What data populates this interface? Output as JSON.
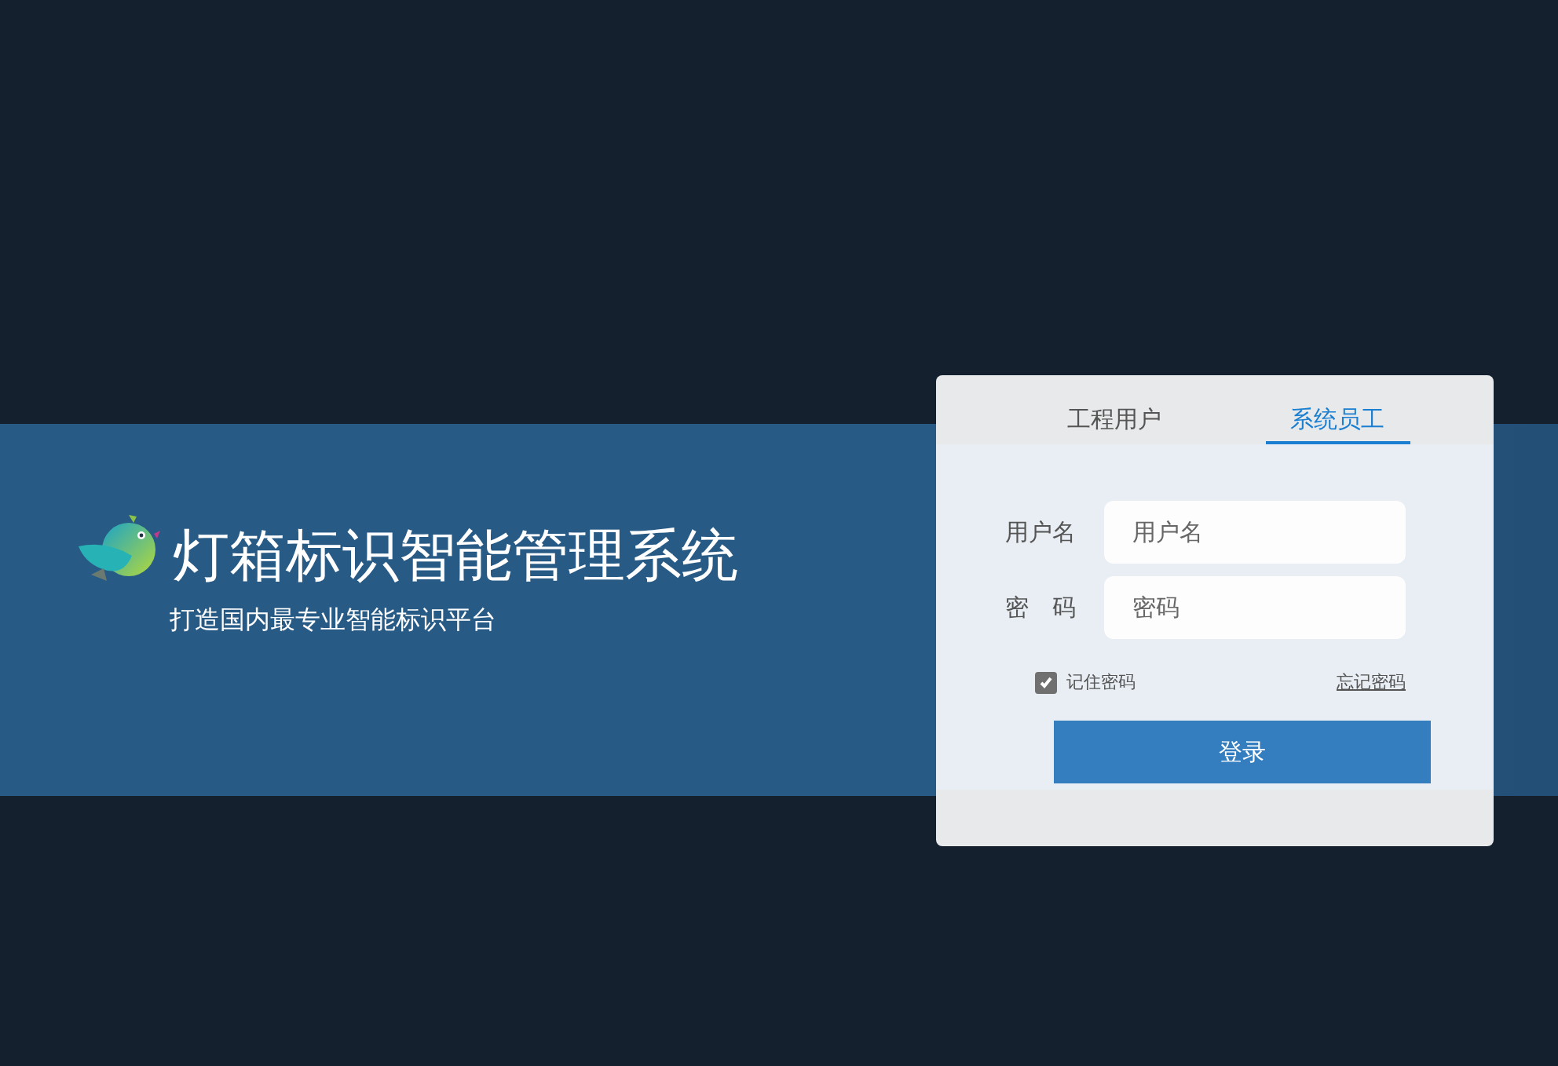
{
  "brand": {
    "title": "灯箱标识智能管理系统",
    "subtitle": "打造国内最专业智能标识平台"
  },
  "login": {
    "tabs": [
      {
        "label": "工程用户",
        "selected": false
      },
      {
        "label": "系统员工",
        "selected": true
      }
    ],
    "fields": [
      {
        "label": "用户名",
        "placeholder": "用户名"
      },
      {
        "label": "密　码",
        "placeholder": "密码"
      }
    ],
    "remember": {
      "label": "记住密码",
      "checked": true
    },
    "forgot": "忘记密码",
    "submit": "登录"
  }
}
